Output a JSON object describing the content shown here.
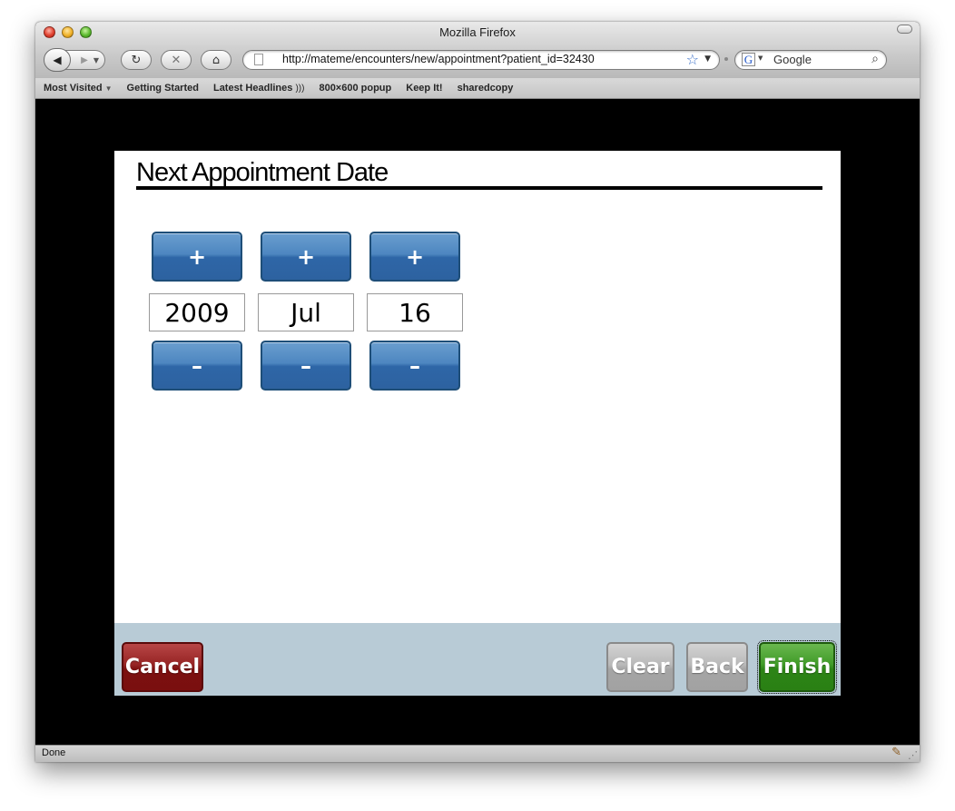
{
  "window": {
    "title": "Mozilla Firefox"
  },
  "toolbar": {
    "url": "http://mateme/encounters/new/appointment?patient_id=32430",
    "search_engine_glyph": "G",
    "search_placeholder": "Google",
    "icons": [
      "back-icon",
      "forward-icon",
      "reload-icon",
      "stop-icon",
      "home-icon",
      "bookmark-star-icon",
      "search-icon"
    ]
  },
  "bookmarks": {
    "items": [
      {
        "label": "Most Visited",
        "has_dropdown": true
      },
      {
        "label": "Getting Started"
      },
      {
        "label": "Latest Headlines",
        "has_rss": true
      },
      {
        "label": "800×600 popup"
      },
      {
        "label": "Keep It!"
      },
      {
        "label": "sharedcopy"
      }
    ]
  },
  "page": {
    "heading": "Next Appointment Date",
    "date": {
      "year": "2009",
      "month": "Jul",
      "day": "16"
    },
    "increment_label": "+",
    "decrement_label": "–",
    "footer": {
      "cancel": "Cancel",
      "clear": "Clear",
      "back": "Back",
      "finish": "Finish"
    }
  },
  "status": {
    "text": "Done"
  },
  "colors": {
    "spinner_blue": "#2e66a7",
    "cancel_red": "#7c1010",
    "finish_green": "#2c8416",
    "footer_bg": "#b8cbd6"
  }
}
